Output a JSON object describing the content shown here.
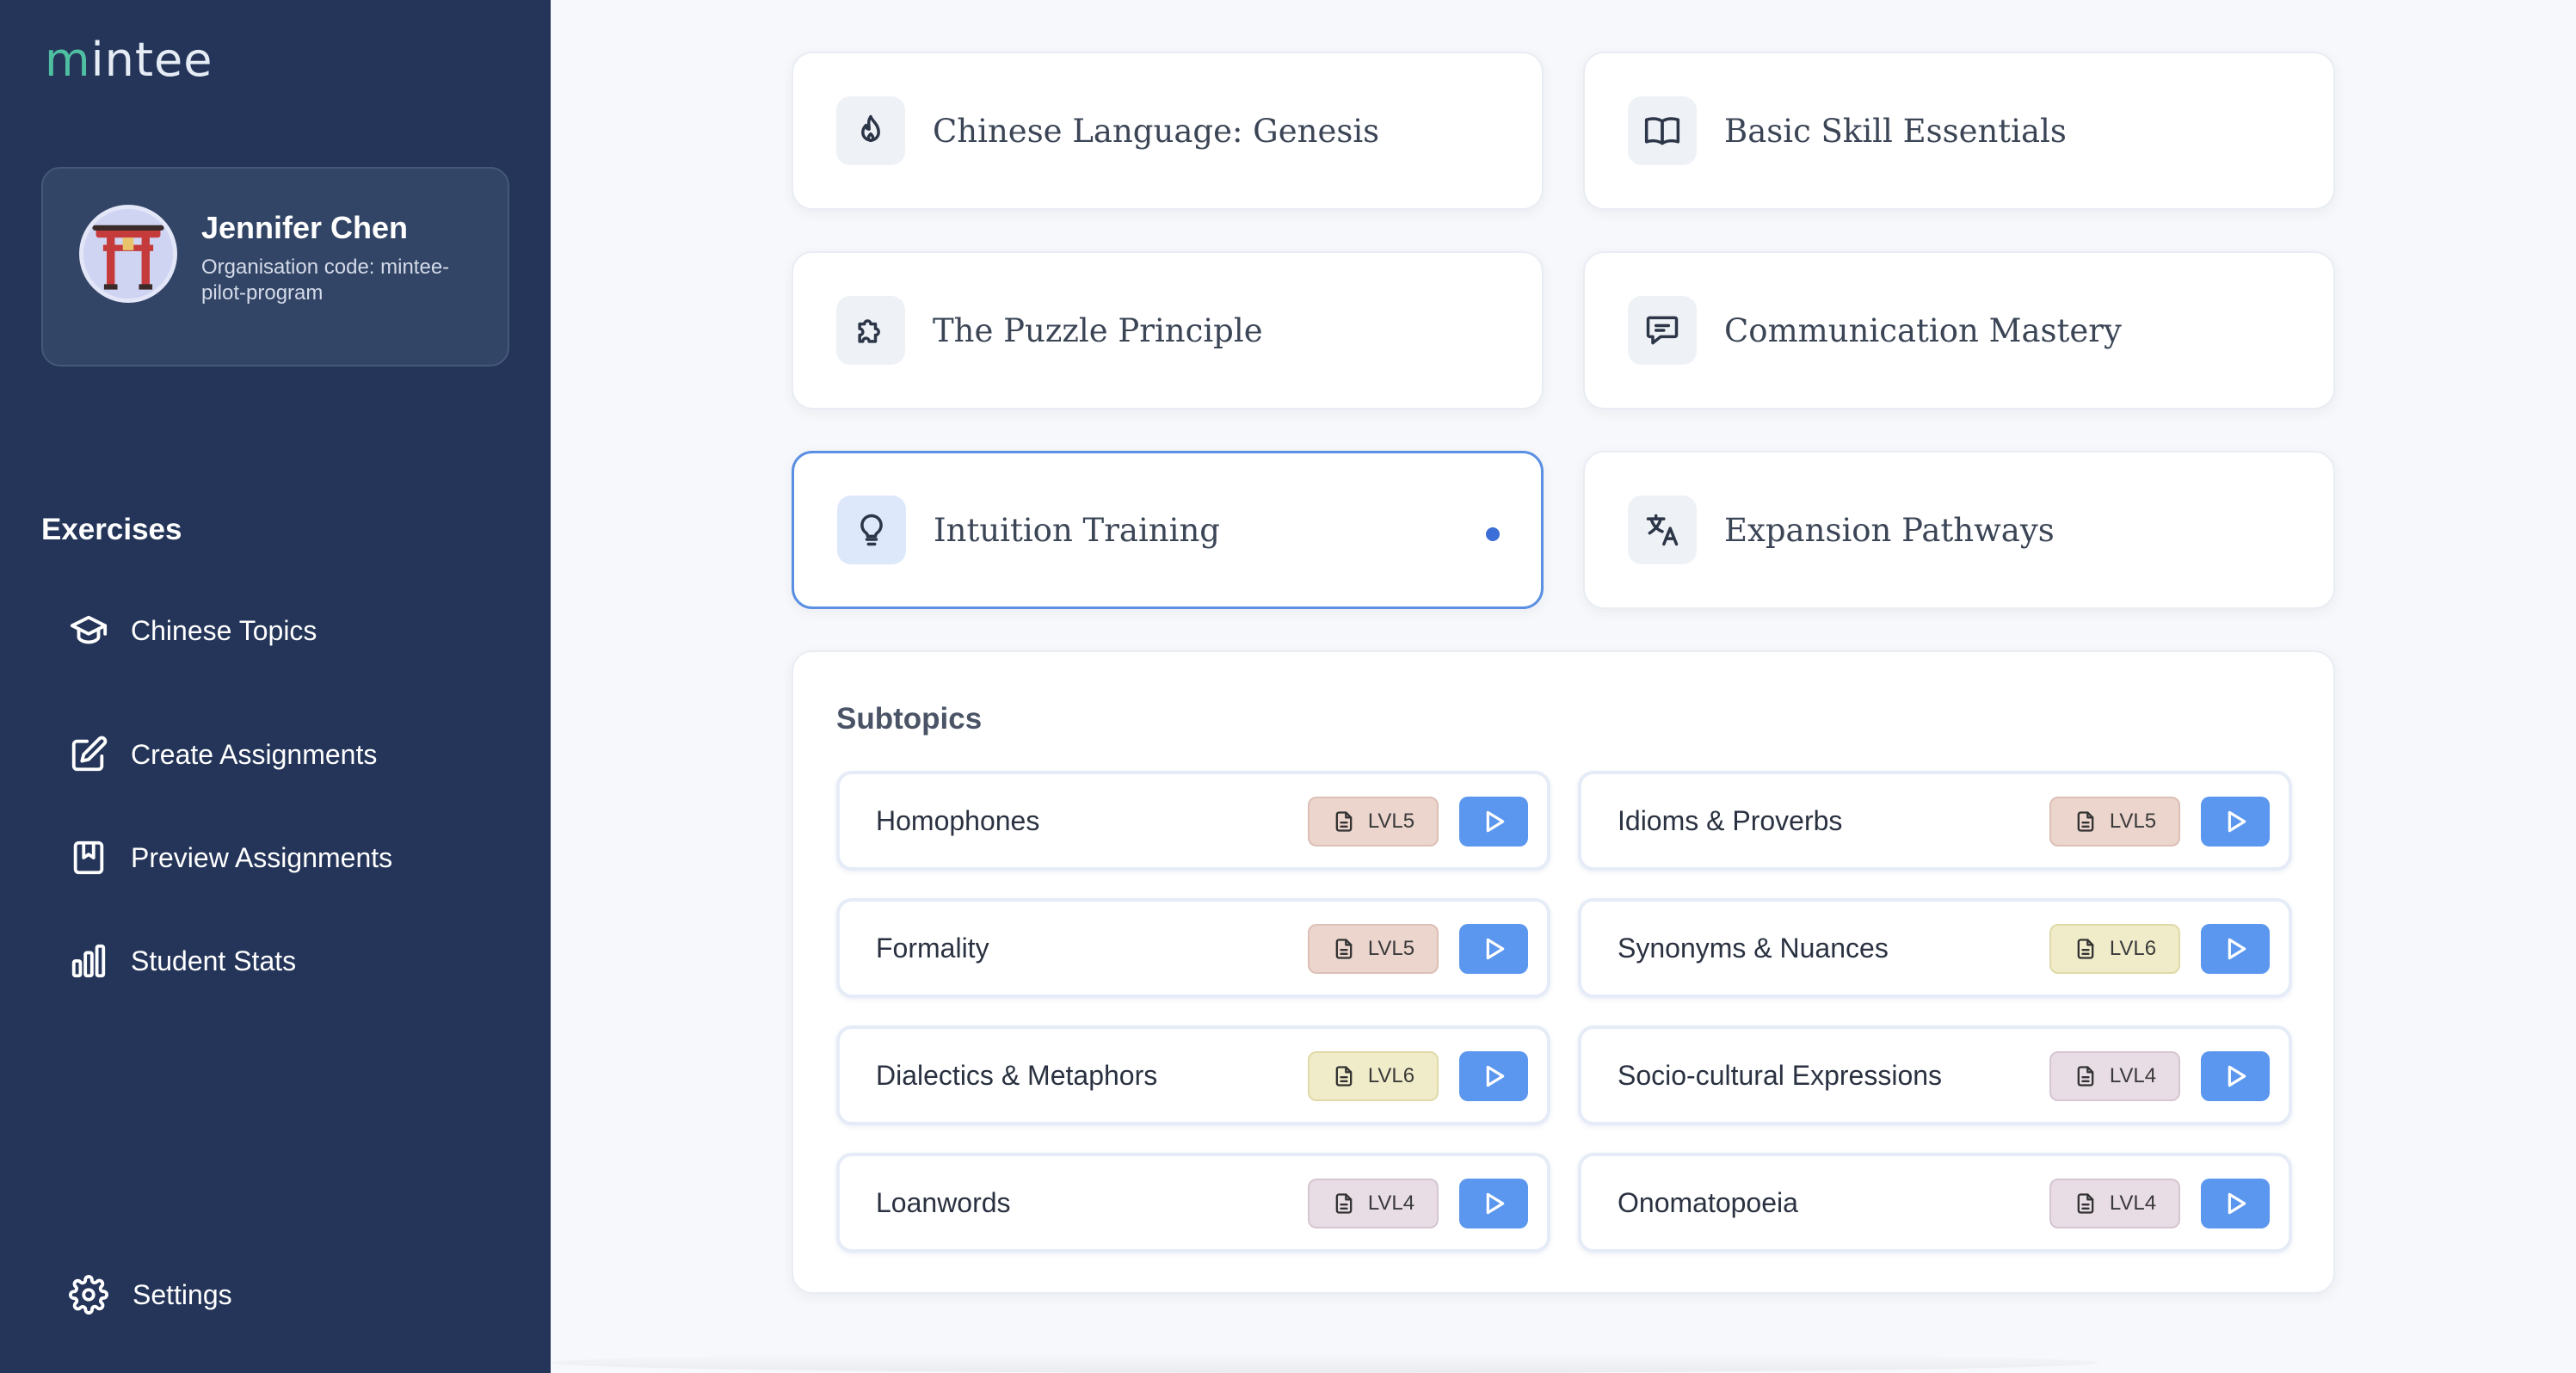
{
  "app": {
    "logo_text": "intee",
    "logo_accent": "m"
  },
  "profile": {
    "name": "Jennifer Chen",
    "org": "Organisation code: mintee-pilot-program"
  },
  "sidebar": {
    "section_title": "Exercises",
    "items": [
      {
        "label": "Chinese Topics",
        "icon": "graduation-cap-icon"
      },
      {
        "label": "Create Assignments",
        "icon": "edit-icon"
      },
      {
        "label": "Preview Assignments",
        "icon": "bookmark-book-icon"
      },
      {
        "label": "Student Stats",
        "icon": "bar-chart-icon"
      }
    ],
    "settings_label": "Settings"
  },
  "topics": [
    {
      "label": "Chinese Language: Genesis",
      "icon": "flame-icon",
      "active": false
    },
    {
      "label": "Basic Skill Essentials",
      "icon": "open-book-icon",
      "active": false
    },
    {
      "label": "The Puzzle Principle",
      "icon": "puzzle-icon",
      "active": false
    },
    {
      "label": "Communication Mastery",
      "icon": "chat-icon",
      "active": false
    },
    {
      "label": "Intuition Training",
      "icon": "lightbulb-icon",
      "active": true
    },
    {
      "label": "Expansion Pathways",
      "icon": "translate-icon",
      "active": false
    }
  ],
  "subtopics": {
    "title": "Subtopics",
    "items": [
      {
        "label": "Homophones",
        "level": "LVL5"
      },
      {
        "label": "Idioms & Proverbs",
        "level": "LVL5"
      },
      {
        "label": "Formality",
        "level": "LVL5"
      },
      {
        "label": "Synonyms & Nuances",
        "level": "LVL6"
      },
      {
        "label": "Dialectics & Metaphors",
        "level": "LVL6"
      },
      {
        "label": "Socio-cultural Expressions",
        "level": "LVL4"
      },
      {
        "label": "Loanwords",
        "level": "LVL4"
      },
      {
        "label": "Onomatopoeia",
        "level": "LVL4"
      }
    ]
  },
  "colors": {
    "sidebar_bg": "#243559",
    "accent_blue": "#5b97ee",
    "active_border": "#5b8fe3",
    "lvl5_bg": "#ecd5cd",
    "lvl6_bg": "#f0ecc9",
    "lvl4_bg": "#e8dce5"
  }
}
